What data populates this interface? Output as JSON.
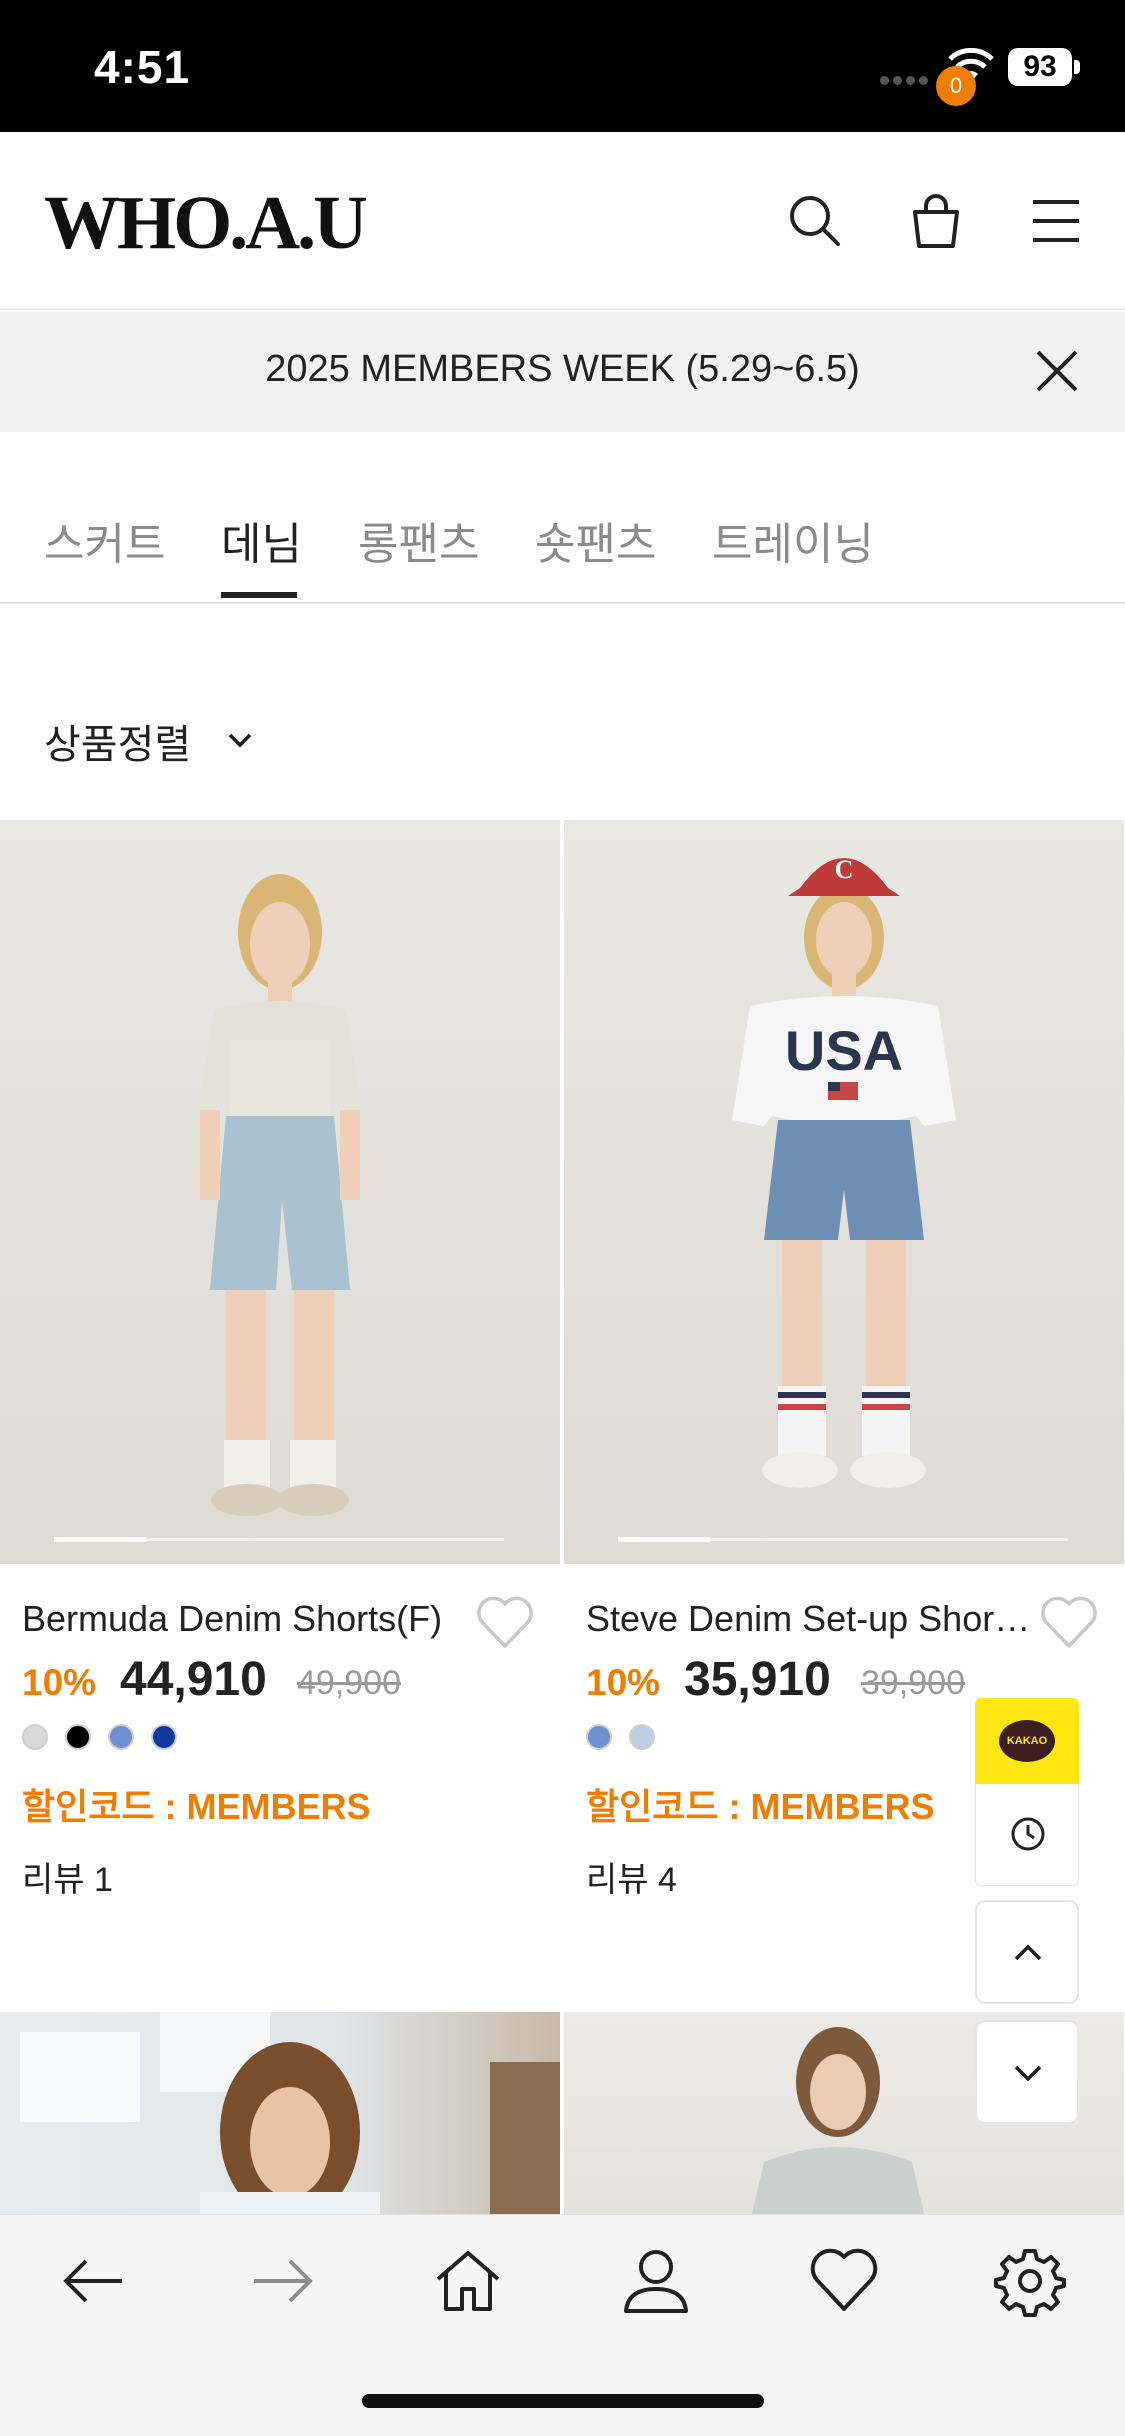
{
  "status_bar": {
    "time": "4:51",
    "battery": "93"
  },
  "header": {
    "logo": "WHO.A.U",
    "cart_count": "0"
  },
  "banner": {
    "text": "2025 MEMBERS WEEK (5.29~6.5)"
  },
  "tabs": [
    {
      "label": "스커트",
      "active": false
    },
    {
      "label": "데님",
      "active": true
    },
    {
      "label": "롱팬츠",
      "active": false
    },
    {
      "label": "숏팬츠",
      "active": false
    },
    {
      "label": "트레이닝",
      "active": false
    }
  ],
  "sort": {
    "label": "상품정렬"
  },
  "products": [
    {
      "name": "Bermuda Denim Shorts(F)",
      "discount": "10%",
      "price": "44,910",
      "original_price": "49,900",
      "swatches": [
        "#d9d9d9",
        "#000000",
        "#6f8fd0",
        "#1239a3"
      ],
      "code": "할인코드 : MEMBERS",
      "review": "리뷰 1"
    },
    {
      "name": "Steve Denim Set-up Shor…",
      "discount": "10%",
      "price": "35,910",
      "original_price": "39,900",
      "swatches": [
        "#6f8fd0",
        "#bccfe3"
      ],
      "code": "할인코드 : MEMBERS",
      "review": "리뷰 4"
    }
  ],
  "floating": {
    "kakao_label": "KAKAO"
  },
  "colors": {
    "accent": "#f07d00",
    "kakao": "#ffe812"
  }
}
